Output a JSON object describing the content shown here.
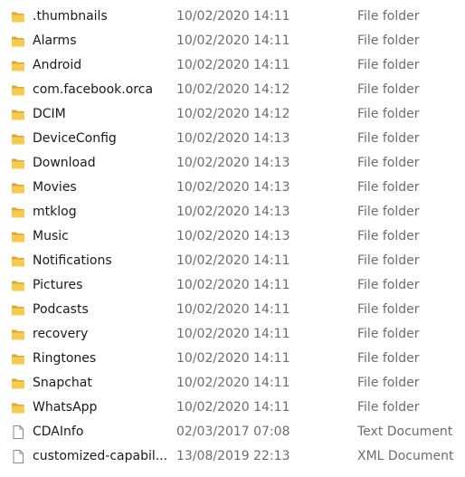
{
  "files": [
    {
      "name": ".thumbnails",
      "date": "10/02/2020 14:11",
      "type": "File folder",
      "icon": "folder-icon"
    },
    {
      "name": "Alarms",
      "date": "10/02/2020 14:11",
      "type": "File folder",
      "icon": "folder-icon"
    },
    {
      "name": "Android",
      "date": "10/02/2020 14:11",
      "type": "File folder",
      "icon": "folder-icon"
    },
    {
      "name": "com.facebook.orca",
      "date": "10/02/2020 14:12",
      "type": "File folder",
      "icon": "folder-icon"
    },
    {
      "name": "DCIM",
      "date": "10/02/2020 14:12",
      "type": "File folder",
      "icon": "folder-icon"
    },
    {
      "name": "DeviceConfig",
      "date": "10/02/2020 14:13",
      "type": "File folder",
      "icon": "folder-icon"
    },
    {
      "name": "Download",
      "date": "10/02/2020 14:13",
      "type": "File folder",
      "icon": "folder-icon"
    },
    {
      "name": "Movies",
      "date": "10/02/2020 14:13",
      "type": "File folder",
      "icon": "folder-icon"
    },
    {
      "name": "mtklog",
      "date": "10/02/2020 14:13",
      "type": "File folder",
      "icon": "folder-icon"
    },
    {
      "name": "Music",
      "date": "10/02/2020 14:13",
      "type": "File folder",
      "icon": "folder-icon"
    },
    {
      "name": "Notifications",
      "date": "10/02/2020 14:11",
      "type": "File folder",
      "icon": "folder-icon"
    },
    {
      "name": "Pictures",
      "date": "10/02/2020 14:11",
      "type": "File folder",
      "icon": "folder-icon"
    },
    {
      "name": "Podcasts",
      "date": "10/02/2020 14:11",
      "type": "File folder",
      "icon": "folder-icon"
    },
    {
      "name": "recovery",
      "date": "10/02/2020 14:11",
      "type": "File folder",
      "icon": "folder-icon"
    },
    {
      "name": "Ringtones",
      "date": "10/02/2020 14:11",
      "type": "File folder",
      "icon": "folder-icon"
    },
    {
      "name": "Snapchat",
      "date": "10/02/2020 14:11",
      "type": "File folder",
      "icon": "folder-icon"
    },
    {
      "name": "WhatsApp",
      "date": "10/02/2020 14:11",
      "type": "File folder",
      "icon": "folder-icon"
    },
    {
      "name": "CDAInfo",
      "date": "02/03/2017 07:08",
      "type": "Text Document",
      "icon": "document-icon"
    },
    {
      "name": "customized-capabil...",
      "date": "13/08/2019 22:13",
      "type": "XML Document",
      "icon": "document-icon"
    }
  ],
  "colors": {
    "folder_back": "#e2a630",
    "folder_front": "#f8ca4f",
    "document_fill": "#ffffff",
    "document_stroke": "#8a8a8a"
  }
}
